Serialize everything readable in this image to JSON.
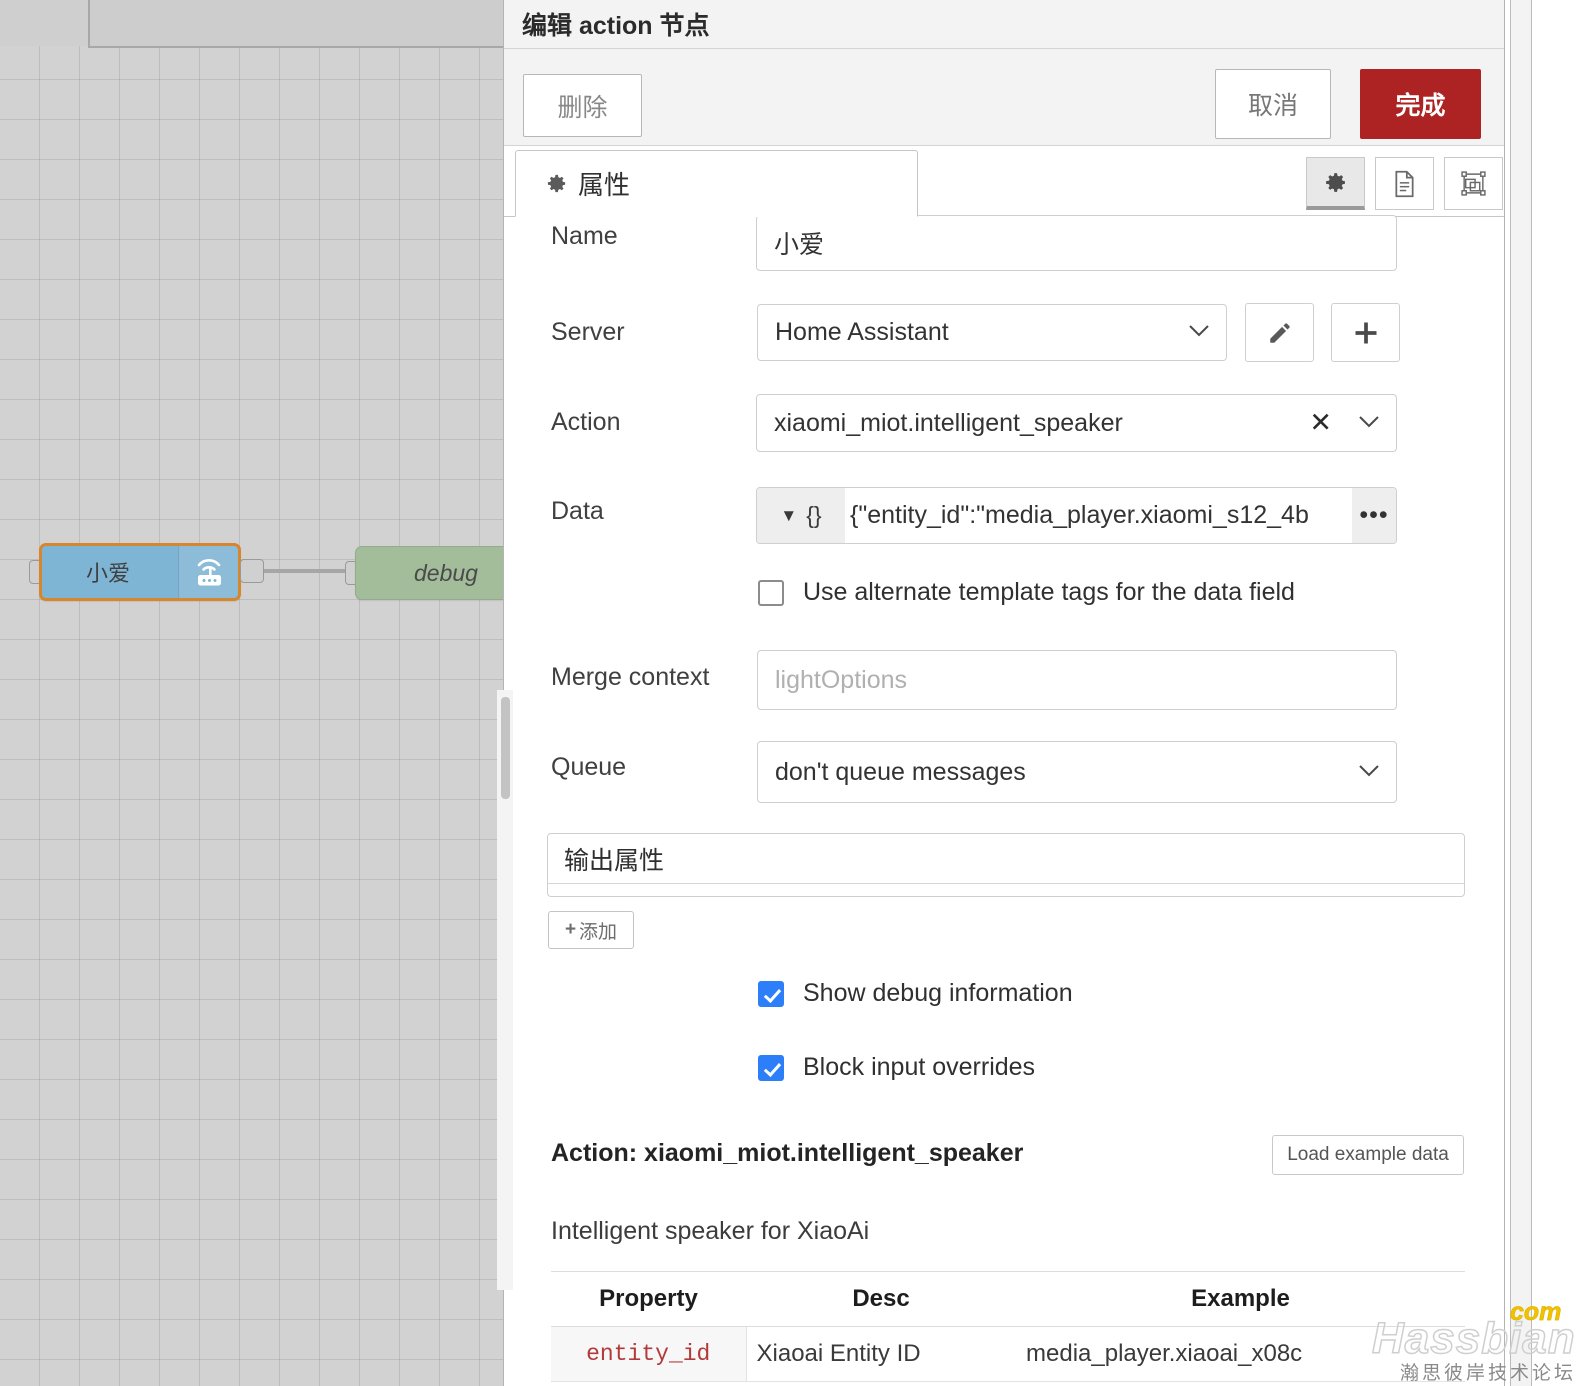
{
  "canvas": {
    "nodes": [
      {
        "name": "小爱",
        "icon": "wifi-router-icon",
        "type": "home-assistant-action"
      },
      {
        "name": "debug",
        "icon": "none",
        "type": "debug"
      }
    ]
  },
  "dialog": {
    "title": "编辑 action 节点",
    "buttons": {
      "delete": "删除",
      "cancel": "取消",
      "done": "完成"
    },
    "tabs": [
      {
        "label": "属性",
        "icon": "gear-icon",
        "active": true
      }
    ],
    "icon_buttons": [
      {
        "name": "gear-icon",
        "active": true
      },
      {
        "name": "description-icon",
        "active": false
      },
      {
        "name": "appearance-icon",
        "active": false
      }
    ]
  },
  "form": {
    "name": {
      "label": "Name",
      "value": "小爱"
    },
    "server": {
      "label": "Server",
      "value": "Home Assistant",
      "edit_icon": "pencil-icon",
      "add_icon": "plus-icon"
    },
    "action": {
      "label": "Action",
      "value": "xiaomi_miot.intelligent_speaker",
      "clear_icon": "close-icon",
      "caret": "chevron-down-icon"
    },
    "data": {
      "label": "Data",
      "type_label": "{}",
      "value": "{\"entity_id\":\"media_player.xiaomi_s12_4b",
      "expand": "•••"
    },
    "use_alternate_tags": {
      "label": "Use alternate template tags for the data field",
      "checked": false
    },
    "merge_context": {
      "label": "Merge context",
      "value": "",
      "placeholder": "lightOptions"
    },
    "queue": {
      "label": "Queue",
      "value": "don't queue messages"
    },
    "output_properties": {
      "title": "输出属性",
      "add_label": "添加"
    },
    "show_debug": {
      "label": "Show debug information",
      "checked": true
    },
    "block_input": {
      "label": "Block input overrides",
      "checked": true
    }
  },
  "action_info": {
    "heading": "Action: xiaomi_miot.intelligent_speaker",
    "load_example_label": "Load example data",
    "description": "Intelligent speaker for XiaoAi",
    "table": {
      "headers": [
        "Property",
        "Desc",
        "Example"
      ],
      "rows": [
        [
          "entity_id",
          "Xiaoai Entity ID",
          "media_player.xiaoai_x08c"
        ]
      ]
    }
  },
  "sidebar": {
    "tabs": [
      {
        "name": "debug-tab",
        "icon": "bug-icon"
      }
    ]
  },
  "watermark": {
    "main": "Hassbian",
    "tld": "com",
    "sub": "瀚思彼岸技术论坛"
  },
  "colors": {
    "accent_done": "#ad2323",
    "checkbox": "#2d7ff9",
    "node_ha": "#7fb5d4",
    "node_ha_border": "#d6862e",
    "node_debug": "#a3bd9a",
    "code_text": "#b33a3a"
  }
}
